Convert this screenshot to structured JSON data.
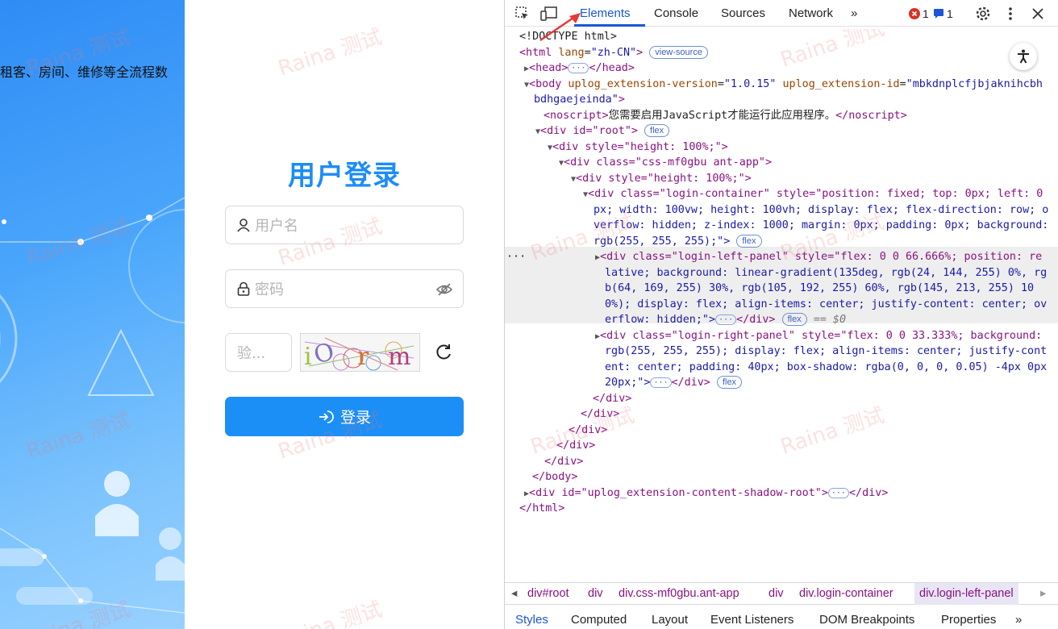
{
  "left_panel": {
    "description_text": "租客、房间、维修等全流程数"
  },
  "login": {
    "title": "用户登录",
    "username_placeholder": "用户名",
    "password_placeholder": "密码",
    "captcha_placeholder": "验...",
    "captcha_text": "iOrm",
    "login_label": "登录"
  },
  "watermark": "Raina 测试",
  "devtools": {
    "tabs": [
      "Elements",
      "Console",
      "Sources",
      "Network"
    ],
    "more_tabs": "»",
    "error_count": "1",
    "message_count": "1",
    "elements": {
      "doctype": "<!DOCTYPE html>",
      "html_open": "<html",
      "html_lang_attr": "lang",
      "html_lang_val": "\"zh-CN\"",
      "view_source": "view-source",
      "head": "<head>",
      "head_close": "</head>",
      "body_line1_tag": "<body",
      "body_attr1": "uplog_extension-version",
      "body_val1": "\"1.0.15\"",
      "body_attr2": "uplog_extension-id",
      "body_val2a": "\"mbkdnplcfjbjaknihcbh",
      "body_val2b": "bdhgaejeinda\"",
      "noscript_open": "<noscript>",
      "noscript_text": "您需要启用JavaScript才能运行此应用程序。",
      "noscript_close": "</noscript>",
      "root_div": "<div id=\"root\">",
      "flex": "flex",
      "div_style_h": "<div style=\"height: 100%;\">",
      "div_class_app": "<div class=\"css-mf0gbu ant-app\">",
      "div_style_h2": "<div style=\"height: 100%;\">",
      "lc_line1": "<div class=\"login-container\" style=\"position: fixed; top: 0px; left: 0",
      "lc_line2": "px; width: 100vw; height: 100vh; display: flex; flex-direction: row; o",
      "lc_line3": "verflow: hidden; z-index: 1000; margin: 0px; padding: 0px; background:",
      "lc_line4": "rgb(255, 255, 255);\">",
      "lp_line1": "<div class=\"login-left-panel\" style=\"flex: 0 0 66.666%; position: re",
      "lp_line2": "lative; background: linear-gradient(135deg, rgb(24, 144, 255) 0%, rg",
      "lp_line3": "b(64, 169, 255) 30%, rgb(105, 192, 255) 60%, rgb(145, 213, 255) 10",
      "lp_line4": "0%); display: flex; align-items: center; justify-content: center; ov",
      "lp_line5": "erflow: hidden;\">",
      "lp_close": "</div>",
      "eq_dollar": "== $0",
      "rp_line1": "<div class=\"login-right-panel\" style=\"flex: 0 0 33.333%; background:",
      "rp_line2": "rgb(255, 255, 255); display: flex; align-items: center; justify-cont",
      "rp_line3": "ent: center; padding: 40px; box-shadow: rgba(0, 0, 0, 0.05) -4px 0px",
      "rp_line4": "20px;\">",
      "div_close": "</div>",
      "body_close": "</body>",
      "shadow_root": "<div id=\"uplog_extension-content-shadow-root\">",
      "html_close": "</html>",
      "ellipsis": "···"
    },
    "breadcrumbs": [
      "div#root",
      "div",
      "div.css-mf0gbu.ant-app",
      "div",
      "div.login-container",
      "div.login-left-panel"
    ],
    "subtabs": [
      "Styles",
      "Computed",
      "Layout",
      "Event Listeners",
      "DOM Breakpoints",
      "Properties",
      "»"
    ]
  },
  "colors": {
    "brand_blue": "#1b8ff6",
    "devtools_accent": "#1a56d6"
  }
}
